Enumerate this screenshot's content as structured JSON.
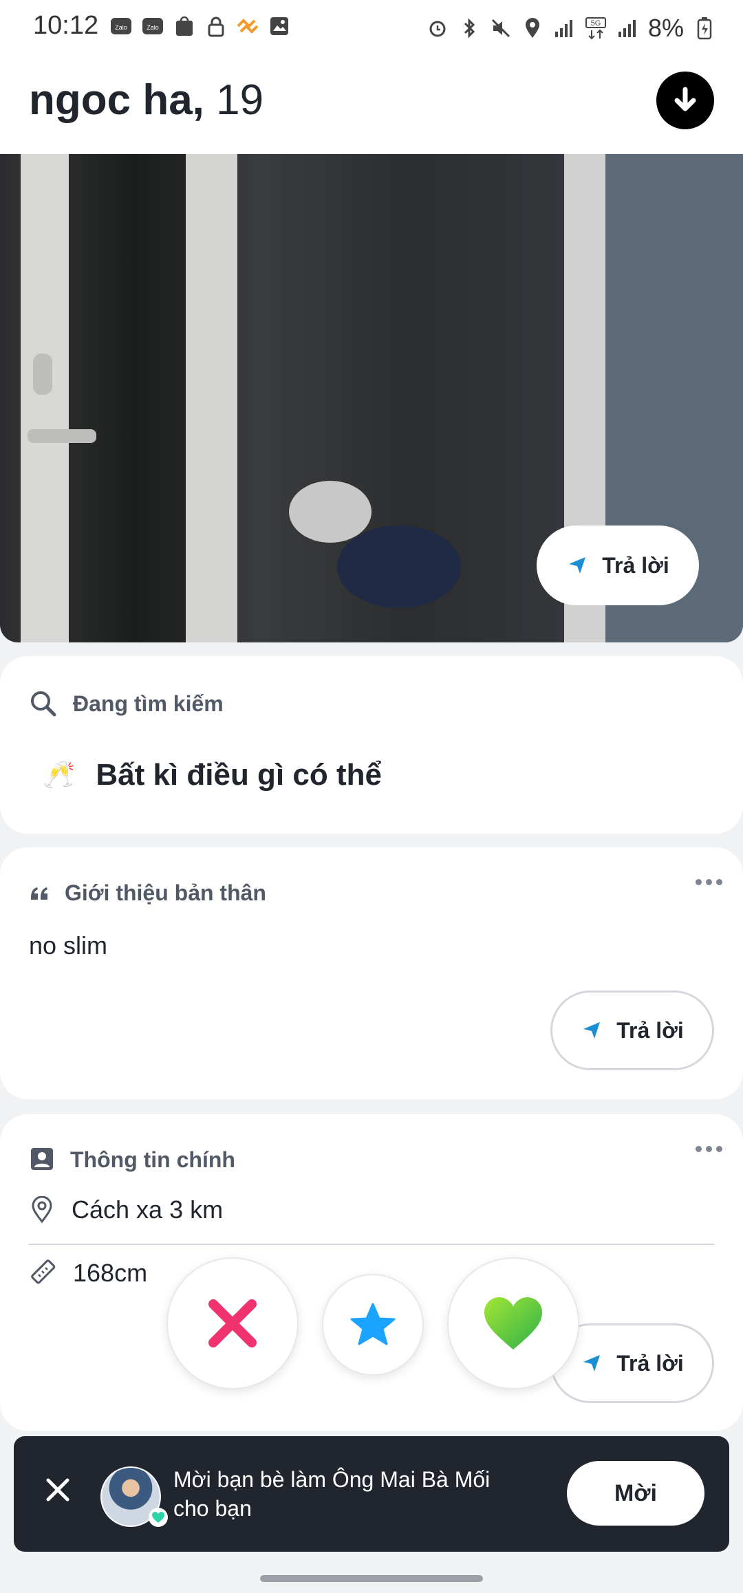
{
  "status": {
    "time": "10:12",
    "battery": "8%",
    "left_icons": [
      "zalo-icon",
      "zalo-icon",
      "shopee-icon",
      "lock-icon",
      "app-icon",
      "image-icon"
    ],
    "right_icons": [
      "alarm-icon",
      "bluetooth-icon",
      "mute-icon",
      "location-icon",
      "signal-icon",
      "5g-signal-icon",
      "signal-icon",
      "battery-icon"
    ]
  },
  "profile": {
    "name": "ngoc ha,",
    "age": "19"
  },
  "photo_reply": {
    "label": "Trả lời"
  },
  "looking_for": {
    "title": "Đang tìm kiếm",
    "value": "Bất kì điều gì có thể",
    "emoji": "🥂"
  },
  "bio": {
    "title": "Giới thiệu bản thân",
    "text": "no slim",
    "reply_label": "Trả lời"
  },
  "basics": {
    "title": "Thông tin chính",
    "distance": "Cách xa 3 km",
    "height": "168cm",
    "reply_label": "Trả lời"
  },
  "actions": {
    "nope": "nope-icon",
    "super_like": "star-icon",
    "like": "heart-icon"
  },
  "colors": {
    "nope": "#f0336f",
    "super_like": "#1aa3ff",
    "like": "#54c53c",
    "reply_arrow": "#1a8fd6"
  },
  "banner": {
    "text": "Mời bạn bè làm Ông Mai Bà Mối cho bạn",
    "invite_label": "Mời"
  }
}
